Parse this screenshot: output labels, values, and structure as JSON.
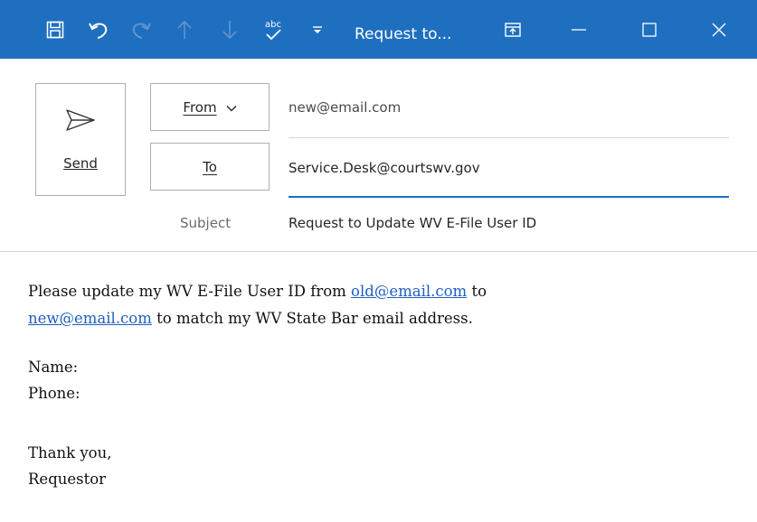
{
  "window": {
    "title": "Request to...",
    "accent_color": "#1f6fc0",
    "titlebar_icons": [
      "save-icon",
      "undo-icon",
      "redo-icon",
      "previous-item-icon",
      "next-item-icon",
      "spelling-icon",
      "customize-toolbar-icon",
      "ribbon-display-icon",
      "minimize-icon",
      "maximize-icon",
      "close-icon"
    ]
  },
  "compose": {
    "send_label": "Send",
    "from_label": "From",
    "from_value": "new@email.com",
    "to_label": "To",
    "to_value": "Service.Desk@courtswv.gov",
    "subject_label": "Subject",
    "subject_value": "Request to Update WV E-File User ID"
  },
  "body": {
    "line1_pre": "Please update my WV E-File User ID from ",
    "line1_link": "old@email.com",
    "line1_post": " to",
    "line2_link": "new@email.com",
    "line2_post": " to match my WV State Bar email address.",
    "name_label": "Name:",
    "phone_label": "Phone:",
    "closing": "Thank you,",
    "signature": "Requestor",
    "link_color": "#1f5fbf"
  }
}
